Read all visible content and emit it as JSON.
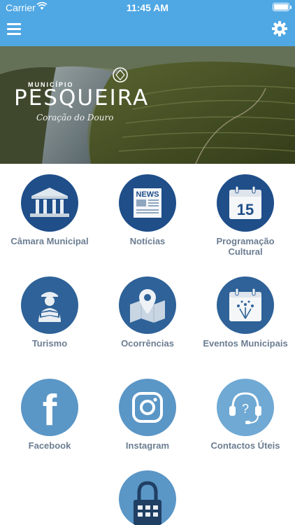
{
  "status_bar": {
    "carrier": "Carrier",
    "time": "11:45 AM"
  },
  "header": {
    "background": "#4fa7e4",
    "menu_icon": "hamburger-menu-icon",
    "settings_icon": "gear-icon"
  },
  "banner": {
    "municipality_label": "MUNICÍPIO",
    "municipality_name": "PESQUEIRA",
    "tagline": "Coração do Douro"
  },
  "tiles": [
    {
      "label": "Câmara Municipal",
      "icon": "town-hall-icon"
    },
    {
      "label": "Notícias",
      "icon": "newspaper-icon",
      "icon_text": "NEWS"
    },
    {
      "label": "Programação Cultural",
      "icon": "calendar-icon",
      "icon_text": "15"
    },
    {
      "label": "Turismo",
      "icon": "tourist-icon"
    },
    {
      "label": "Ocorrências",
      "icon": "map-pin-icon"
    },
    {
      "label": "Eventos Municipais",
      "icon": "event-calendar-icon"
    },
    {
      "label": "Facebook",
      "icon": "facebook-icon",
      "icon_text": "f"
    },
    {
      "label": "Instagram",
      "icon": "instagram-icon"
    },
    {
      "label": "Contactos Úteis",
      "icon": "headset-icon",
      "icon_text": "?"
    },
    {
      "label": "",
      "icon": "lock-icon"
    }
  ]
}
